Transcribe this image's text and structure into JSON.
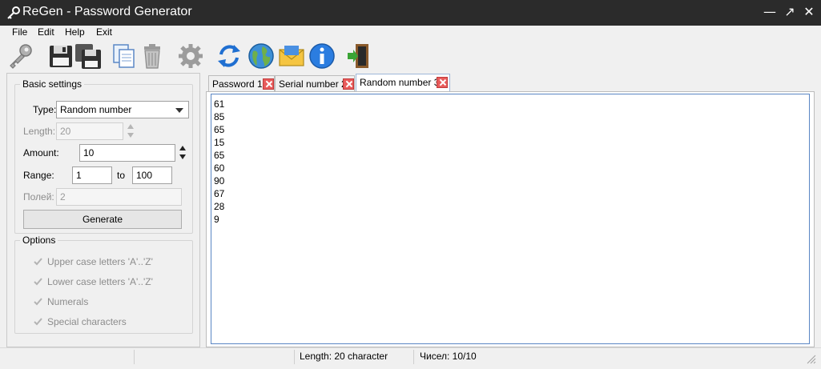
{
  "window": {
    "title": "ReGen - Password Generator"
  },
  "menu": [
    "File",
    "Edit",
    "Help",
    "Exit"
  ],
  "toolbar": {
    "buttons": [
      "key-icon",
      "save-icon",
      "save-all-icon",
      "copy-icon",
      "trash-icon",
      "gear-icon",
      "refresh-icon",
      "globe-icon",
      "mail-icon",
      "info-icon",
      "exit-door-icon"
    ]
  },
  "basic_settings": {
    "title": "Basic settings",
    "type_label": "Type:",
    "type_value": "Random number",
    "length_label": "Length:",
    "length_value": "20",
    "amount_label": "Amount:",
    "amount_value": "10",
    "range_label": "Range:",
    "range_from": "1",
    "range_to_label": "to",
    "range_to": "100",
    "fields_label": "Полей:",
    "fields_value": "2",
    "generate_label": "Generate"
  },
  "options": {
    "title": "Options",
    "items": [
      {
        "label": "Upper case letters 'A'..'Z'",
        "checked": true
      },
      {
        "label": "Lower case letters 'A'..'Z'",
        "checked": true
      },
      {
        "label": "Numerals",
        "checked": true
      },
      {
        "label": "Special characters",
        "checked": true
      }
    ]
  },
  "tabs": [
    {
      "label": "Password 1"
    },
    {
      "label": "Serial number 2"
    },
    {
      "label": "Random number 3",
      "active": true
    }
  ],
  "output_lines": [
    "61",
    "85",
    "65",
    "15",
    "65",
    "60",
    "90",
    "67",
    "28",
    "9"
  ],
  "status": {
    "length": "Length: 20 character",
    "count": "Чисел: 10/10"
  },
  "colors": {
    "titlebar": "#2b2b2b",
    "tab_close": "#e85b5b",
    "output_border": "#5a86c4"
  }
}
